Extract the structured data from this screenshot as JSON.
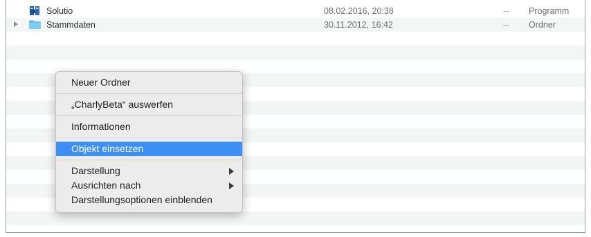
{
  "files": [
    {
      "name": "Solutio",
      "date": "08.02.2016, 20:38",
      "size": "--",
      "kind": "Programm",
      "icon": "app-icon",
      "expandable": false
    },
    {
      "name": "Stammdaten",
      "date": "30.11.2012, 16:42",
      "size": "--",
      "kind": "Ordner",
      "icon": "folder-icon",
      "expandable": true
    }
  ],
  "context_menu": {
    "new_folder": "Neuer Ordner",
    "eject": "„CharlyBeta“ auswerfen",
    "info": "Informationen",
    "paste": "Objekt einsetzen",
    "view": "Darstellung",
    "arrange_by": "Ausrichten nach",
    "show_view_options": "Darstellungsoptionen einblenden"
  },
  "colors": {
    "selection": "#3d8ef5",
    "folder": "#6cc3f0",
    "stripe": "#f4f5f5"
  }
}
